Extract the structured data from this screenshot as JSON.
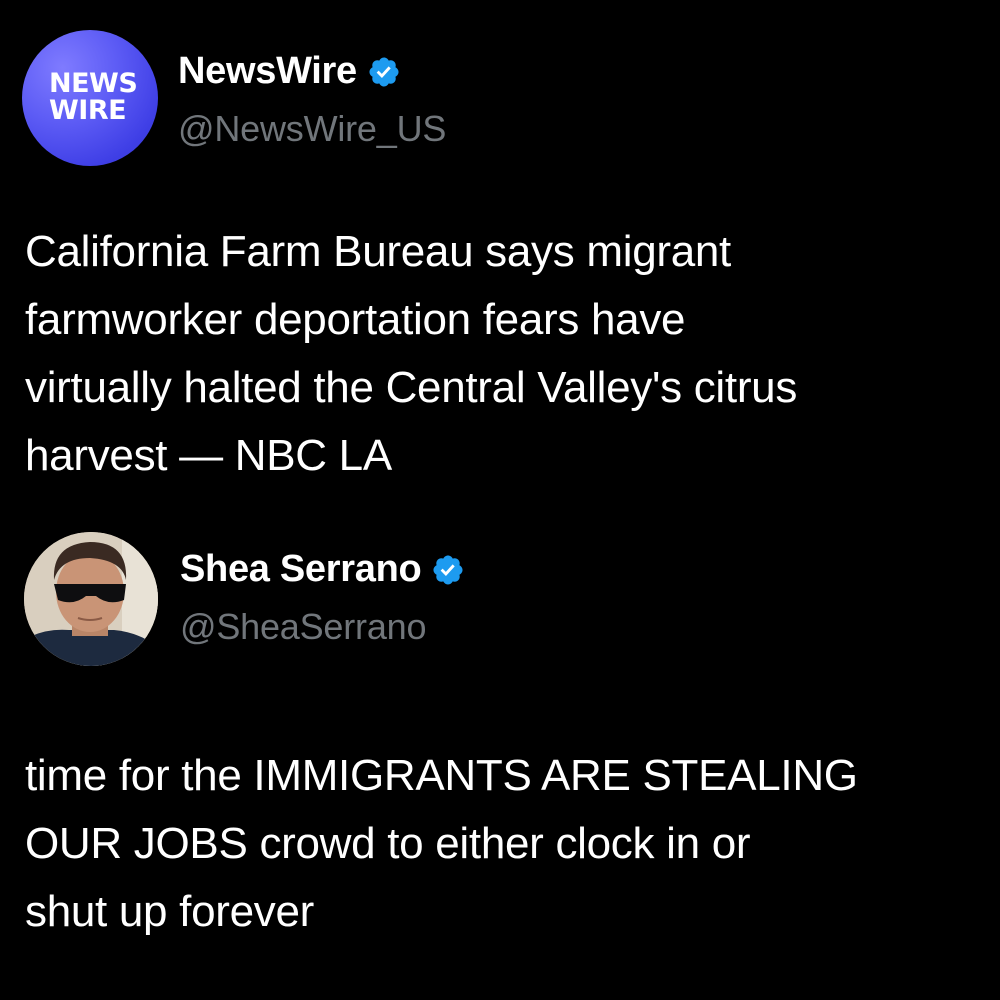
{
  "posts": [
    {
      "author": {
        "display_name": "NewsWire",
        "handle": "@NewsWire_US",
        "verified": true,
        "avatar_logo_lines": [
          "NEWS",
          "WIRE"
        ],
        "avatar_colors": [
          "#7f7bff",
          "#3434cf"
        ]
      },
      "text_lines": [
        "California Farm Bureau says migrant",
        "farmworker deportation fears have",
        "virtually halted the Central Valley's citrus",
        "harvest — NBC LA"
      ]
    },
    {
      "author": {
        "display_name": "Shea Serrano",
        "handle": "@SheaSerrano",
        "verified": true,
        "avatar": "profile-photo-icon"
      },
      "text_lines": [
        "time for the IMMIGRANTS ARE STEALING",
        "OUR JOBS crowd to either clock in or",
        "shut up forever"
      ]
    }
  ],
  "colors": {
    "background": "#000000",
    "name": "#ffffff",
    "handle": "#71767b",
    "text": "#ffffff",
    "verified_badge": "#1d9bf0"
  }
}
